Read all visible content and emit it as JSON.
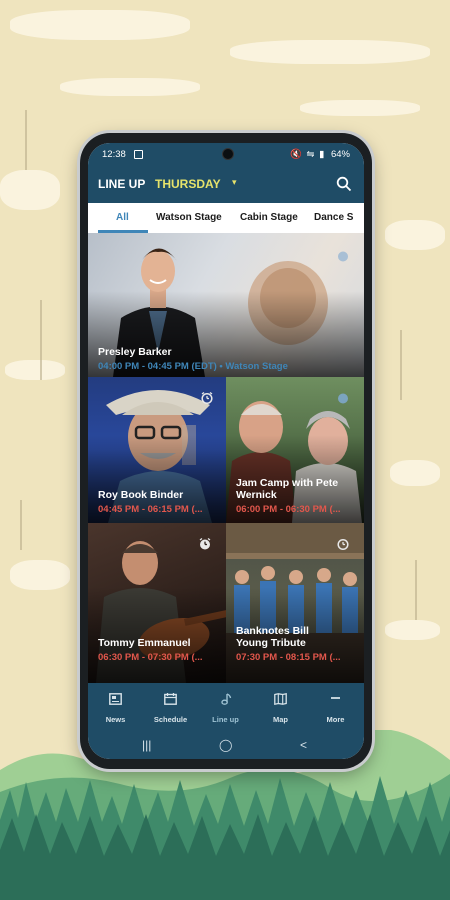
{
  "status_bar": {
    "time": "12:38",
    "battery": "64%",
    "indicators": "🔇 ⇋ ▮"
  },
  "app_bar": {
    "title": "LINE UP",
    "day": "THURSDAY",
    "caret": "▾",
    "search_icon": "search-icon"
  },
  "tabs": [
    "All",
    "Watson Stage",
    "Cabin Stage",
    "Dance S"
  ],
  "active_tab": "All",
  "performers": [
    {
      "name": "Presley Barker",
      "time": "04:00 PM - 04:45 PM (EDT) • Watson Stage",
      "time_color": "#3f86b8",
      "alarm_set": false
    },
    {
      "name": "Roy Book Binder",
      "time": "04:45 PM - 06:15 PM (...",
      "time_color": "#e2574c",
      "alarm_set": false
    },
    {
      "name": "Jam Camp with Pete",
      "name2": "Wernick",
      "time": "06:00 PM - 06:30 PM (...",
      "time_color": "#e2574c",
      "alarm_set": false
    },
    {
      "name": "Tommy Emmanuel",
      "time": "06:30 PM - 07:30 PM (...",
      "time_color": "#e2574c",
      "alarm_set": true
    },
    {
      "name": "Banknotes Bill",
      "name2": "Young Tribute",
      "time": "07:30 PM - 08:15 PM (...",
      "time_color": "#e2574c",
      "alarm_set": false
    }
  ],
  "bottom_nav": [
    {
      "label": "News",
      "icon": "news-icon"
    },
    {
      "label": "Schedule",
      "icon": "calendar-icon"
    },
    {
      "label": "Line up",
      "icon": "music-note-icon"
    },
    {
      "label": "Map",
      "icon": "map-icon"
    },
    {
      "label": "More",
      "icon": "more-icon"
    }
  ],
  "active_nav": "Line up",
  "system_nav": {
    "recents": "|||",
    "home": "◯",
    "back": "<"
  }
}
